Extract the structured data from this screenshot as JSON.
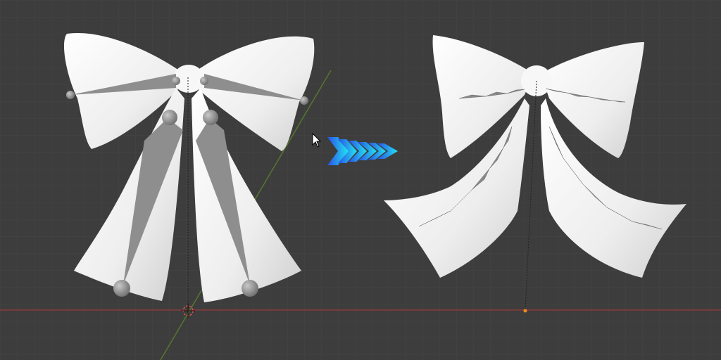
{
  "viewport": {
    "background": "#3d3d3d",
    "grid_color": "#474747",
    "x_axis_color": "#8a3b3b",
    "y_axis_color": "#55772e",
    "bow_color": "#f4f4f4",
    "bone_color": "#8e8e8e"
  },
  "icons": {
    "arrow": "chevron-right-arrow-icon",
    "cursor": "mouse-pointer-icon",
    "origin": "3d-cursor-icon"
  },
  "arrow_gradient": [
    "#2a55e6",
    "#25e0f0"
  ]
}
